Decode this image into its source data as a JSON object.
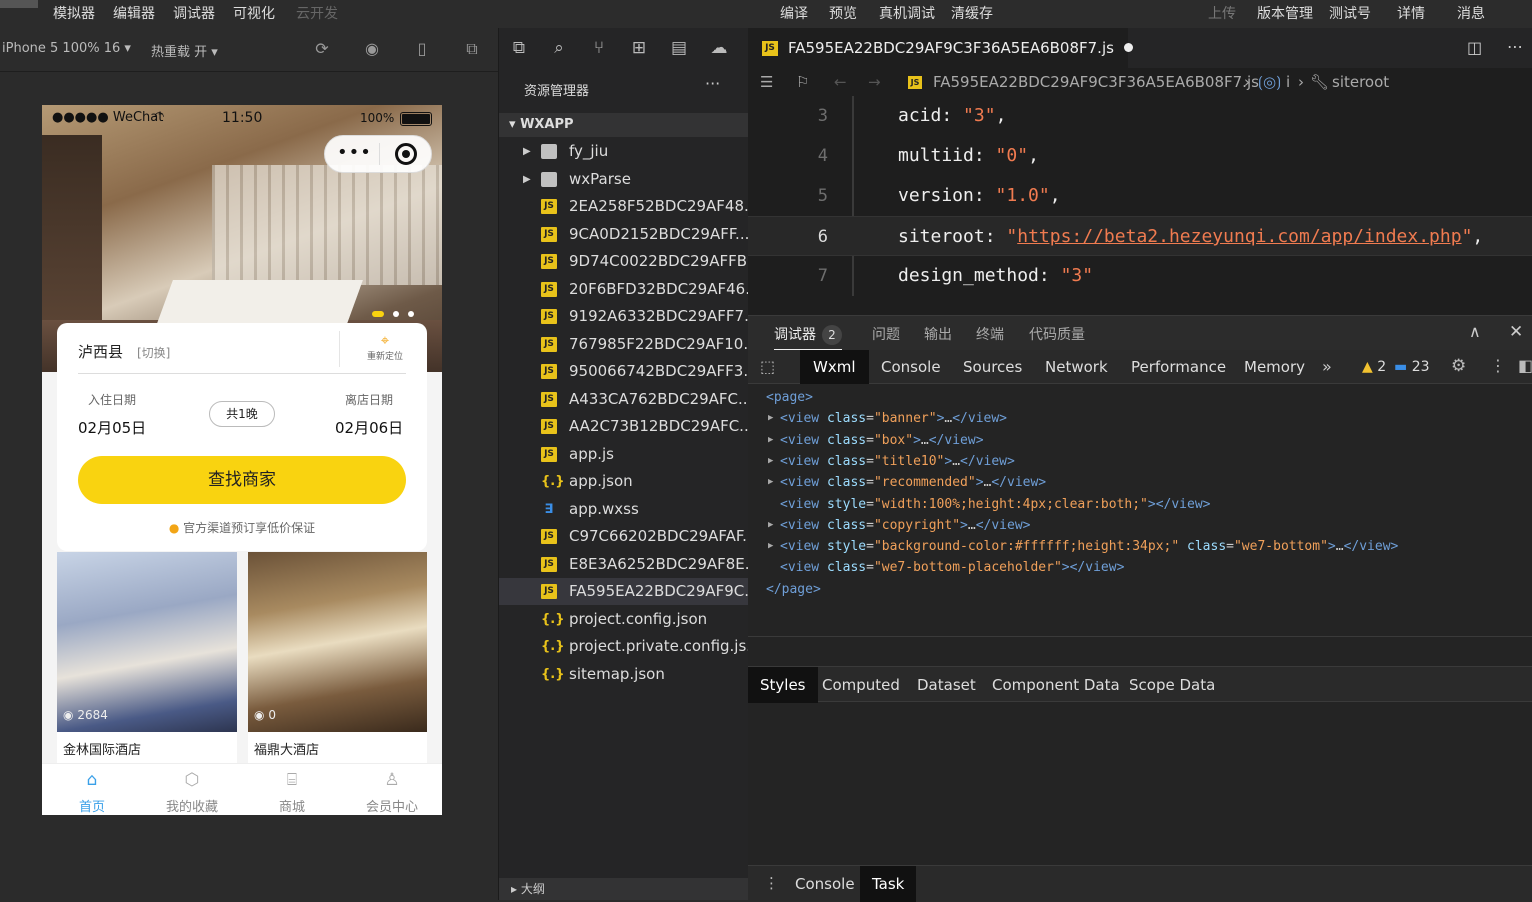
{
  "menubar": {
    "left": [
      "模拟器",
      "编辑器",
      "调试器",
      "可视化",
      "云开发"
    ],
    "center": [
      "编译",
      "预览",
      "真机调试",
      "清缓存"
    ],
    "right": [
      "上传",
      "版本管理",
      "测试号",
      "详情",
      "消息"
    ]
  },
  "simulator": {
    "device": "iPhone 5 100% 16 ▾",
    "hotreload": "热重载 开 ▾",
    "status": {
      "carrier": "●●●●● WeChat",
      "time": "11:50",
      "battery": "100%"
    },
    "card": {
      "city": "泸西县",
      "switch": "[切换]",
      "relocate": "重新定位",
      "checkin_label": "入住日期",
      "checkin_date": "02月05日",
      "nights": "共1晚",
      "checkout_label": "离店日期",
      "checkout_date": "02月06日",
      "find_button": "查找商家",
      "guarantee": "官方渠道预订享低价保证"
    },
    "hotels": [
      {
        "views": "2684",
        "name": "金林国际酒店"
      },
      {
        "views": "0",
        "name": "福鼎大酒店"
      }
    ],
    "tabbar": [
      "首页",
      "我的收藏",
      "商城",
      "会员中心"
    ]
  },
  "explorer": {
    "title": "资源管理器",
    "more": "···",
    "root": "WXAPP",
    "files": [
      {
        "name": "fy_jiu",
        "type": "folder"
      },
      {
        "name": "wxParse",
        "type": "folder"
      },
      {
        "name": "2EA258F52BDC29AF48...",
        "type": "js"
      },
      {
        "name": "9CA0D2152BDC29AFF...",
        "type": "js"
      },
      {
        "name": "9D74C0022BDC29AFFB...",
        "type": "js"
      },
      {
        "name": "20F6BFD32BDC29AF46...",
        "type": "js"
      },
      {
        "name": "9192A6332BDC29AFF7...",
        "type": "js"
      },
      {
        "name": "767985F22BDC29AF10...",
        "type": "js"
      },
      {
        "name": "950066742BDC29AFF3...",
        "type": "js"
      },
      {
        "name": "A433CA762BDC29AFC...",
        "type": "js"
      },
      {
        "name": "AA2C73B12BDC29AFC...",
        "type": "js"
      },
      {
        "name": "app.js",
        "type": "js"
      },
      {
        "name": "app.json",
        "type": "json"
      },
      {
        "name": "app.wxss",
        "type": "wxss"
      },
      {
        "name": "C97C66202BDC29AFAF...",
        "type": "js"
      },
      {
        "name": "E8E3A6252BDC29AF8E...",
        "type": "js"
      },
      {
        "name": "FA595EA22BDC29AF9C...",
        "type": "js"
      },
      {
        "name": "project.config.json",
        "type": "json"
      },
      {
        "name": "project.private.config.js...",
        "type": "json"
      },
      {
        "name": "sitemap.json",
        "type": "json"
      }
    ],
    "selected_index": 16,
    "outline": "大纲"
  },
  "editor": {
    "tab": "FA595EA22BDC29AF9C3F36A5EA6B08F7.js",
    "breadcrumb_file": "FA595EA22BDC29AF9C3F36A5EA6B08F7.js",
    "breadcrumb_mid": "i",
    "breadcrumb_symbol": "siteroot",
    "lines": [
      {
        "n": "3",
        "key": "acid",
        "val": "\"3\""
      },
      {
        "n": "4",
        "key": "multiid",
        "val": "\"0\""
      },
      {
        "n": "5",
        "key": "version",
        "val": "\"1.0\""
      },
      {
        "n": "6",
        "key": "siteroot",
        "val": "https://beta2.hezeyunqi.com/app/index.php"
      },
      {
        "n": "7",
        "key": "design_method",
        "val": "\"3\""
      }
    ]
  },
  "devtools": {
    "tabs": [
      "调试器",
      "问题",
      "输出",
      "终端",
      "代码质量"
    ],
    "debugger_badge": "2",
    "subtabs": [
      "Wxml",
      "Console",
      "Sources",
      "Network",
      "Performance",
      "Memory"
    ],
    "warnings": "2",
    "messages": "23",
    "wxml": [
      {
        "t": "<page>"
      },
      {
        "t": "<view class=\"banner\">…</view>",
        "expand": true
      },
      {
        "t": "<view class=\"box\">…</view>",
        "expand": true
      },
      {
        "t": "<view class=\"title10\">…</view>",
        "expand": true
      },
      {
        "t": "<view class=\"recommended\">…</view>",
        "expand": true
      },
      {
        "t": "<view style=\"width:100%;height:4px;clear:both;\"></view>"
      },
      {
        "t": "<view class=\"copyright\">…</view>",
        "expand": true
      },
      {
        "t": "<view style=\"background-color:#ffffff;height:34px;\" class=\"we7-bottom\">…</view>",
        "expand": true
      },
      {
        "t": "<view class=\"we7-bottom-placeholder\"></view>"
      },
      {
        "t": "</page>"
      }
    ],
    "style_tabs": [
      "Styles",
      "Computed",
      "Dataset",
      "Component Data",
      "Scope Data"
    ],
    "bottom_tabs": [
      "Console",
      "Task"
    ]
  }
}
